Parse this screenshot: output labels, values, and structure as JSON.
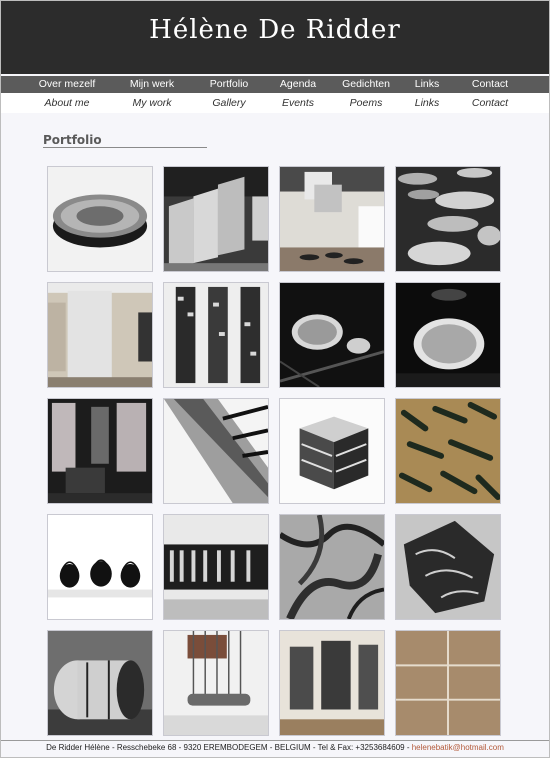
{
  "site": {
    "title": "Hélène De Ridder"
  },
  "nav": {
    "main": [
      "Over mezelf",
      "Mijn werk",
      "Portfolio",
      "Agenda",
      "Gedichten",
      "Links",
      "Contact"
    ],
    "sub": [
      "About me",
      "My work",
      "Gallery",
      "Events",
      "Poems",
      "Links",
      "Contact"
    ]
  },
  "section": {
    "title": "Portfolio"
  },
  "gallery": {
    "rows": 5,
    "cols": 4,
    "thumbnails": [
      "sculpture-disc",
      "hanging-panels",
      "gallery-installation",
      "floor-discs",
      "tall-panels-gallery",
      "brick-pattern-panels",
      "skylight-circles-1",
      "skylight-circles-2",
      "dark-room-panels",
      "diagonal-sculpture",
      "cube-sculpture",
      "branches-wall",
      "black-figures",
      "framed-strip",
      "wood-relief",
      "folded-bag",
      "rolled-bundle",
      "hanging-rolls",
      "three-prints-wall",
      "tile-panels"
    ]
  },
  "footer": {
    "text": "De Ridder Hélène - Resschebeke 68 - 9320 EREMBODEGEM - BELGIUM - Tel & Fax: +3253684609 - ",
    "email": "helenebatik@hotmail.com"
  }
}
